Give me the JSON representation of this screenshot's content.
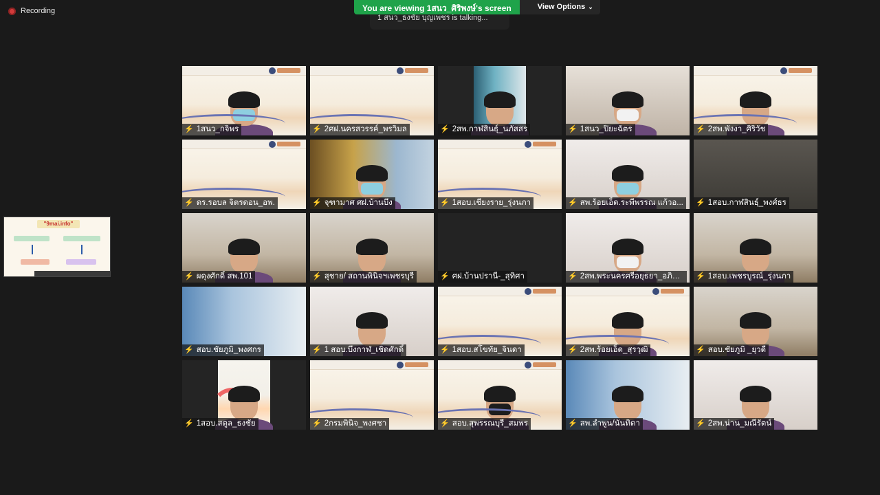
{
  "recording": {
    "label": "Recording"
  },
  "banner": {
    "viewing": "You are viewing 1สนว_ศิริพงษ์'s screen",
    "view_options": "View Options",
    "talking": "1 สนว_ธงชัย บุญเพชร is talking..."
  },
  "shared_thumb": {
    "title": "\"9mai.info\""
  },
  "participants": [
    {
      "name": "1สนว_กจิพร",
      "bg": "slide",
      "person": true,
      "mask": "blue"
    },
    {
      "name": "2ศฝ.นครสวรรค์_พรวิมล",
      "bg": "slide",
      "person": false
    },
    {
      "name": "2สพ.กาฬสินธุ์_นภัสสร",
      "bg": "window",
      "person": true,
      "mask": "none"
    },
    {
      "name": "1สนว_ปิยะฉัตร",
      "bg": "shop",
      "person": true,
      "mask": "white"
    },
    {
      "name": "2สพ.พังงา_ศิริวัช",
      "bg": "slide",
      "person": true,
      "mask": "none"
    },
    {
      "name": "ดร.รอบล จิตรดอน_อพ.",
      "bg": "slide",
      "person": false
    },
    {
      "name": "จุฑามาศ ศฝ.บ้านบึง",
      "bg": "gold",
      "person": true,
      "mask": "blue"
    },
    {
      "name": "1สอบ.เชียงราย_รุ่งนภา",
      "bg": "slide",
      "person": false
    },
    {
      "name": "สพ.ร้อยเอ็ด.ระพีพรรณ แก้วอ...",
      "bg": "room",
      "person": true,
      "mask": "blue"
    },
    {
      "name": "1สอบ.กาฬสินธุ์_พงศ์ธร",
      "bg": "dark",
      "person": false
    },
    {
      "name": "ผดุงศักดิ์ สพ.101",
      "bg": "office",
      "person": true,
      "mask": "none"
    },
    {
      "name": "สุชาย/ สถานพินิจฯเพชรบุรี",
      "bg": "office",
      "person": true,
      "mask": "none"
    },
    {
      "name": "ศฝ.บ้านปรานี-_สุทิศา",
      "bg": "black",
      "person": false
    },
    {
      "name": "2สพ.พระนครศรีอยุธยา_อภิญ...",
      "bg": "room",
      "person": true,
      "mask": "white"
    },
    {
      "name": "1สอบ.เพชรบูรณ์_รุ่งนภา",
      "bg": "office",
      "person": true,
      "mask": "none"
    },
    {
      "name": "สอบ.ชัยภูมิ_พงศกร",
      "bg": "blue",
      "person": false
    },
    {
      "name": "1 สอบ.บึงกาฬ_เชิดศักดิ์",
      "bg": "room",
      "person": true,
      "mask": "none"
    },
    {
      "name": "1สอบ.สโขทัย_จินดา",
      "bg": "slide",
      "person": false
    },
    {
      "name": "2สพ.ร้อยเอ็ด_สุรวุฒิ",
      "bg": "slide",
      "person": true,
      "mask": "none"
    },
    {
      "name": "สอบ.ชัยภูมิ _ยุวดี",
      "bg": "office",
      "person": true,
      "mask": "none"
    },
    {
      "name": "1สอบ.สตูล_ธงชัย",
      "bg": "rainbow",
      "person": true,
      "mask": "none"
    },
    {
      "name": "2กรมพินิจ_พงศชา",
      "bg": "slide",
      "person": false
    },
    {
      "name": "สอบ.สุพรรณบุรี_สมพร",
      "bg": "slide",
      "person": true,
      "mask": "black"
    },
    {
      "name": "สพ.ลำพูน/นันทิดา",
      "bg": "blue",
      "person": true,
      "mask": "none"
    },
    {
      "name": "2สพ.น่าน_มณีรัตน์",
      "bg": "room",
      "person": true,
      "mask": "none"
    }
  ]
}
